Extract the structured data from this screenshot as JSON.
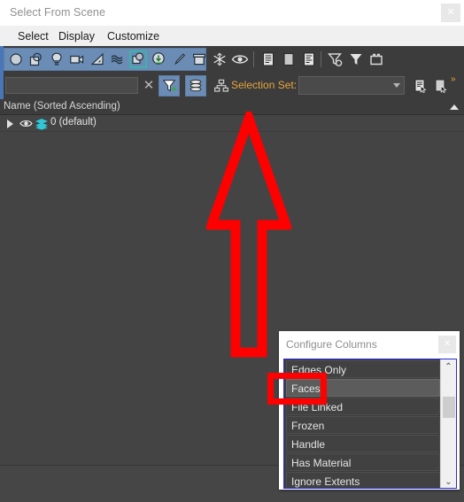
{
  "window": {
    "title": "Select From Scene",
    "close_label": "✕"
  },
  "menubar": {
    "items": [
      {
        "label": "Select",
        "name": "menu-select"
      },
      {
        "label": "Display",
        "name": "menu-display"
      },
      {
        "label": "Customize",
        "name": "menu-customize"
      }
    ]
  },
  "toolbar_filters": {
    "icons": [
      {
        "name": "geometry-filter-icon",
        "title": "Geometry"
      },
      {
        "name": "shapes-filter-icon",
        "title": "Shapes"
      },
      {
        "name": "lights-filter-icon",
        "title": "Lights"
      },
      {
        "name": "cameras-filter-icon",
        "title": "Cameras"
      },
      {
        "name": "helpers-filter-icon",
        "title": "Helpers"
      },
      {
        "name": "space-warps-filter-icon",
        "title": "Space Warps"
      },
      {
        "name": "groups-filter-icon",
        "title": "Groups/Assemblies"
      },
      {
        "name": "xrefs-filter-icon",
        "title": "XRefs"
      },
      {
        "name": "bones-filter-icon",
        "title": "Bones"
      },
      {
        "name": "containers-filter-icon",
        "title": "Containers"
      }
    ],
    "extra_icons": [
      {
        "name": "frozen-icon",
        "title": "Display Frozen"
      },
      {
        "name": "hidden-eye-icon",
        "title": "Display Hidden"
      },
      {
        "name": "list-view-icon",
        "title": "List Types"
      },
      {
        "name": "layers-view-icon",
        "title": "Display Layers"
      },
      {
        "name": "sort-list-icon",
        "title": "Display Influences"
      },
      {
        "name": "filter-settings-icon",
        "title": "Customize Filters"
      },
      {
        "name": "filter-icon",
        "title": "Filter"
      },
      {
        "name": "container-icon",
        "title": "Containers"
      }
    ]
  },
  "search": {
    "value": "",
    "placeholder": "",
    "clear_label": "✕"
  },
  "toolbar_actions": {
    "find-case-icon": "find-case-sensitive-icon",
    "layers-icon": "display-children-icon",
    "hierarchy-icon": "hierarchy-icon",
    "select-set_list_icon": "edit-named-selection-sets-icon",
    "select-set_new_icon": "new-selection-set-icon",
    "overflow_label": "»"
  },
  "selection_set": {
    "label": "Selection Set:",
    "value": "",
    "options": []
  },
  "tree": {
    "column_header": "Name (Sorted Ascending)",
    "sort_indicator": "ascending",
    "rows": [
      {
        "name": "0 (default)",
        "expanded": false,
        "icons": [
          "expand-arrow-icon",
          "eye-icon",
          "layer-icon"
        ]
      }
    ]
  },
  "configure_columns": {
    "title": "Configure Columns",
    "close_label": "✕",
    "items": [
      {
        "label": "Edges Only",
        "selected": false
      },
      {
        "label": "Faces",
        "selected": true
      },
      {
        "label": "File Linked",
        "selected": false
      },
      {
        "label": "Frozen",
        "selected": false
      },
      {
        "label": "Handle",
        "selected": false
      },
      {
        "label": "Has Material",
        "selected": false
      },
      {
        "label": "Ignore Extents",
        "selected": false
      }
    ],
    "scrollbar": {
      "up_label": "⌃",
      "down_label": "⌄"
    }
  },
  "annotations": {
    "arrow": {
      "direction": "up",
      "color": "#fe0000"
    },
    "highlight_rect": {
      "target": "Faces",
      "color": "#fe0000"
    }
  },
  "colors": {
    "panel_bg": "#444444",
    "toolbar_bg": "#3c3c3c",
    "accent_blue": "#6a8cb5",
    "accent_orange": "#e8a43c",
    "annotation_red": "#fe0000",
    "dialog_border_blue": "#2a2adf"
  }
}
